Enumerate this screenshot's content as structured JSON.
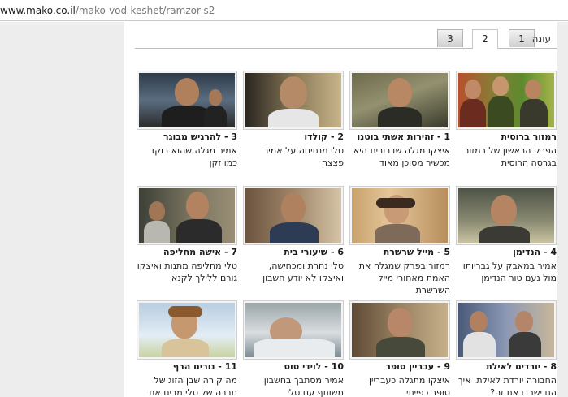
{
  "browser": {
    "url_host": "www.mako.co.il",
    "url_path": "/mako-vod-keshet/ramzor-s2"
  },
  "seasons": {
    "label": "עונה",
    "tabs": [
      "1",
      "2",
      "3"
    ],
    "active": "2"
  },
  "episodes": [
    {
      "title": "רמזור ברוסית",
      "desc": "הפרק הראשון של רמזור בגרסה הרוסית"
    },
    {
      "title": "1 - זהירות אשתי בוטנו",
      "desc": "איצקו מגלה שדבורית היא מכשיר מסוכן מאוד"
    },
    {
      "title": "2 - קולדו",
      "desc": "טלי מנתיחה על אמיר פצצה"
    },
    {
      "title": "3 - להרגיש מבוגר",
      "desc": "אמיר מגלה שהוא רוקד כמו זקן"
    },
    {
      "title": "4 - הנדימן",
      "desc": "אמיר במאבק על גבריותו מול נעם טור הנדימן"
    },
    {
      "title": "5 - מייל שרשרת",
      "desc": "רמזור בפרק שמגלה את האמת מאחורי מייל השרשרת"
    },
    {
      "title": "6 - שיעורי בית",
      "desc": "טלי נחרת ומכחישה, ואיצקו לא יודע חשבון"
    },
    {
      "title": "7 - אישה מחליפה",
      "desc": "טלי מחליפה מתנות ואיצקו גורם ללילך לקנא"
    },
    {
      "title": "8 - יורדים לאילת",
      "desc": "החבורה יורדת לאילת. איך הם ישרדו את זה?"
    },
    {
      "title": "9 - עבריין סופר",
      "desc": "איצקו מתגלה כעבריין סופר כפייתי"
    },
    {
      "title": "10 - לוידי סוס",
      "desc": "אמיר מסתבך בחשבון משותף עם טלי"
    },
    {
      "title": "11 - נורים הרף",
      "desc": "מה קורה שבן הזוג של חברה של טלי מרים את הרף"
    }
  ]
}
